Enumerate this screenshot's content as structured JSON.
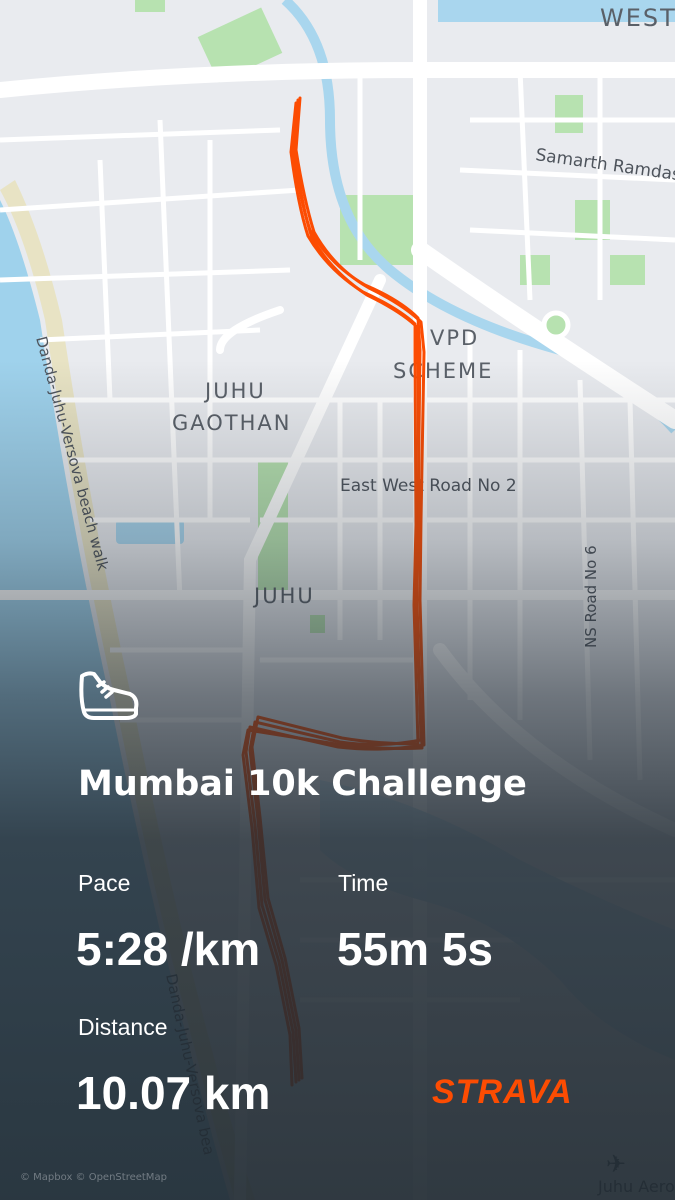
{
  "map": {
    "labels": {
      "west": "WEST",
      "samarth": "Samarth Ramdas",
      "vpd": "VPD",
      "scheme": "SCHEME",
      "juhu_gaothan_1": "JUHU",
      "juhu_gaothan_2": "GAOTHAN",
      "east_west_road": "East West Road No 2",
      "juhu": "JUHU",
      "ns_road": "NS Road No 6",
      "beach_walk": "Danda-Juhu-Versova beach walk",
      "beach_walk_lower": "Danda-Juhu-Versova bea",
      "aerodrome": "Juhu Aerodro"
    },
    "colors": {
      "land": "#e9ebef",
      "road": "#ffffff",
      "park": "#b7e2b0",
      "water": "#a9d6ee",
      "sea": "#9fd2ec",
      "route": "#fc4c02"
    }
  },
  "activity": {
    "icon": "running-shoe-icon",
    "title": "Mumbai 10k Challenge",
    "pace_label": "Pace",
    "pace_value": "5:28 /km",
    "time_label": "Time",
    "time_value": "55m 5s",
    "distance_label": "Distance",
    "distance_value": "10.07 km"
  },
  "brand": {
    "name": "STRAVA",
    "color": "#fc4c02"
  },
  "attribution": "© Mapbox © OpenStreetMap"
}
